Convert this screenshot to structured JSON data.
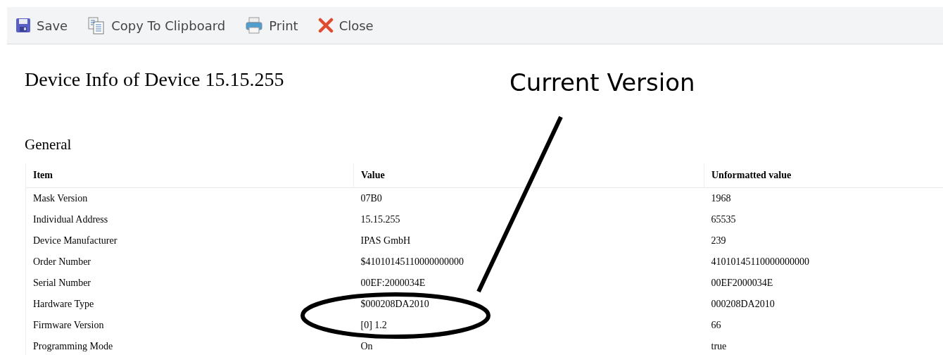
{
  "toolbar": [
    {
      "kind": "save",
      "label": "Save"
    },
    {
      "kind": "copy",
      "label": "Copy To Clipboard"
    },
    {
      "kind": "print",
      "label": "Print"
    },
    {
      "kind": "close",
      "label": "Close"
    }
  ],
  "title": "Device Info of Device 15.15.255",
  "annotation": {
    "label": "Current Version"
  },
  "section": "General",
  "table": {
    "columns": [
      "Item",
      "Value",
      "Unformatted value"
    ],
    "rows": [
      [
        "Mask Version",
        "07B0",
        "1968"
      ],
      [
        "Individual Address",
        "15.15.255",
        "65535"
      ],
      [
        "Device Manufacturer",
        "IPAS GmbH",
        "239"
      ],
      [
        "Order Number",
        "$41010145110000000000",
        "41010145110000000000"
      ],
      [
        "Serial Number",
        "00EF:2000034E",
        "00EF2000034E"
      ],
      [
        "Hardware Type",
        "$000208DA2010",
        "000208DA2010"
      ],
      [
        "Firmware Version",
        "[0] 1.2",
        "66"
      ],
      [
        "Programming Mode",
        "On",
        "true"
      ]
    ]
  }
}
